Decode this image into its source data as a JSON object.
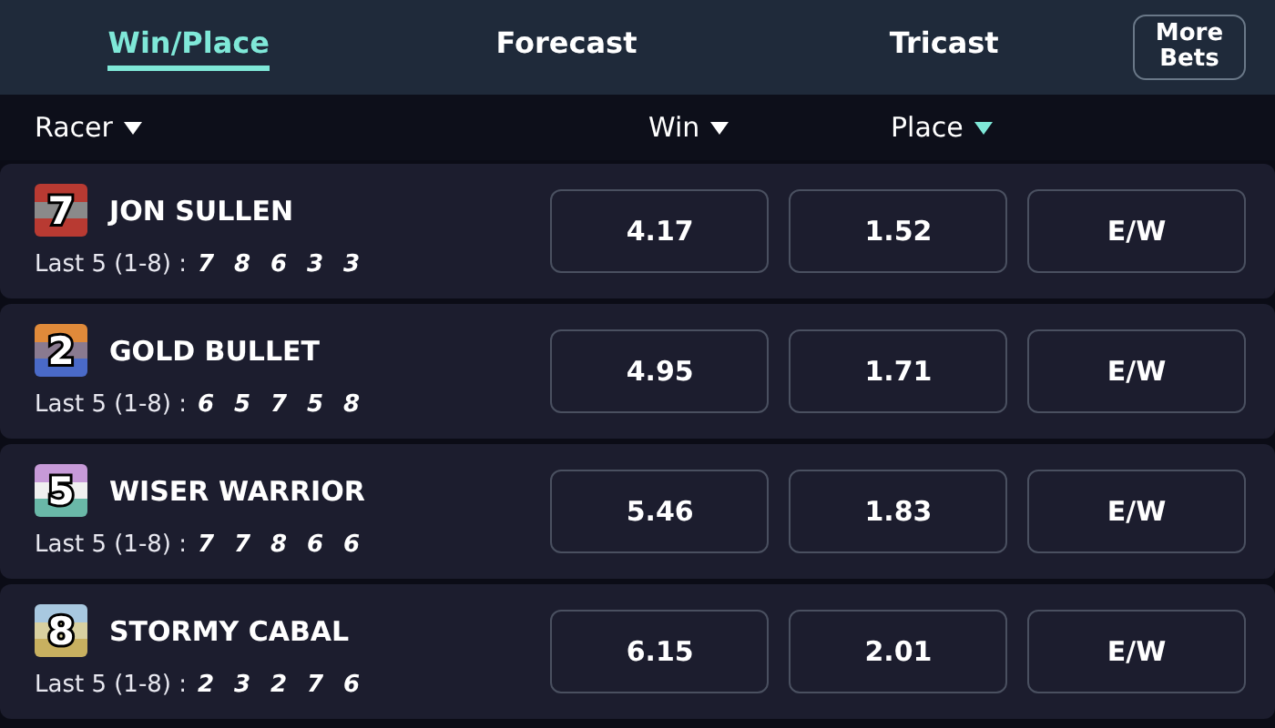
{
  "tabs": [
    {
      "label": "Win/Place",
      "selected": true
    },
    {
      "label": "Forecast",
      "selected": false
    },
    {
      "label": "Tricast",
      "selected": false
    }
  ],
  "more_bets": "More\nBets",
  "columns": [
    {
      "label": "Racer",
      "sorted": false
    },
    {
      "label": "Win",
      "sorted": false
    },
    {
      "label": "Place",
      "sorted": true
    }
  ],
  "racers": [
    {
      "number": "7",
      "name": "JON SULLEN",
      "form_label": "Last 5 (1-8) :",
      "form": [
        "7",
        "8",
        "6",
        "3",
        "3"
      ],
      "silk": [
        {
          "color": "#b83a32"
        },
        {
          "color": "#8a8a8a"
        },
        {
          "color": "#b83a32"
        }
      ],
      "win": "4.17",
      "place": "1.52",
      "each_way": "E/W"
    },
    {
      "number": "2",
      "name": "GOLD BULLET",
      "form_label": "Last 5 (1-8) :",
      "form": [
        "6",
        "5",
        "7",
        "5",
        "8"
      ],
      "silk": [
        {
          "color": "#e08a3a"
        },
        {
          "color": "#8a7a90"
        },
        {
          "color": "#4a6ac8"
        }
      ],
      "win": "4.95",
      "place": "1.71",
      "each_way": "E/W"
    },
    {
      "number": "5",
      "name": "WISER WARRIOR",
      "form_label": "Last 5 (1-8) :",
      "form": [
        "7",
        "7",
        "8",
        "6",
        "6"
      ],
      "silk": [
        {
          "color": "#c79ad8"
        },
        {
          "color": "#f0f0f0"
        },
        {
          "color": "#6ab8a8"
        }
      ],
      "win": "5.46",
      "place": "1.83",
      "each_way": "E/W"
    },
    {
      "number": "8",
      "name": "STORMY CABAL",
      "form_label": "Last 5 (1-8) :",
      "form": [
        "2",
        "3",
        "2",
        "7",
        "6"
      ],
      "silk": [
        {
          "color": "#a8c8e0"
        },
        {
          "color": "#d8d0a0"
        },
        {
          "color": "#c8b060"
        }
      ],
      "win": "6.15",
      "place": "2.01",
      "each_way": "E/W"
    }
  ]
}
